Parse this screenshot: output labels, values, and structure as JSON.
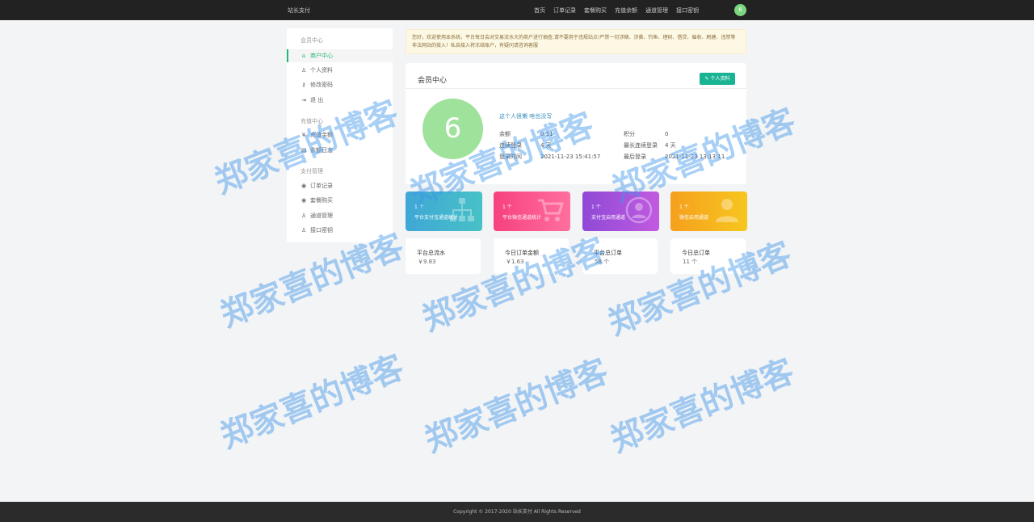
{
  "topbar": {
    "brand": "站长支付",
    "nav": [
      "首页",
      "订单记录",
      "套餐购买",
      "充值余额",
      "通道管理",
      "接口密钥"
    ],
    "avatar_text": "6"
  },
  "sidebar": {
    "section1": "会员中心",
    "section2": "充值中心",
    "section3": "支付管理",
    "items": [
      {
        "label": "商户中心",
        "icon": "home-icon",
        "glyph": "⌂"
      },
      {
        "label": "个人资料",
        "icon": "user-icon",
        "glyph": "♙"
      },
      {
        "label": "修改密码",
        "icon": "key-icon",
        "glyph": "⚷"
      },
      {
        "label": "退 出",
        "icon": "logout-icon",
        "glyph": "⇥"
      },
      {
        "label": "充值余额",
        "icon": "yen-icon",
        "glyph": "¥"
      },
      {
        "label": "余额日志",
        "icon": "list-icon",
        "glyph": "▤"
      },
      {
        "label": "订单记录",
        "icon": "user-circle-icon",
        "glyph": "◉"
      },
      {
        "label": "套餐购买",
        "icon": "user-circle-icon",
        "glyph": "◉"
      },
      {
        "label": "通道管理",
        "icon": "user-icon",
        "glyph": "♙"
      },
      {
        "label": "接口密钥",
        "icon": "user-icon",
        "glyph": "♙"
      }
    ]
  },
  "notice": "您好，欢迎使用本系统，平台每日会对交易流水大的商户进行抽查,请不要用于违规站点!严禁一切涉赌、涉黄、钓鱼、理财、借贷、催收、刷建、违禁等非法网站的接入！私自接入将冻结账户，有疑问请咨询客服",
  "member": {
    "title": "会员中心",
    "profile_button": "个人资料",
    "avatar_text": "6",
    "signature": "这个人很懒 啥也没写",
    "left": [
      {
        "k": "余额",
        "v": "0.11"
      },
      {
        "k": "连续登录",
        "v": "4 天"
      },
      {
        "k": "登录时间",
        "v": "2021-11-23 15:41:57"
      }
    ],
    "right": [
      {
        "k": "积分",
        "v": "0"
      },
      {
        "k": "最长连续登录",
        "v": "4 天"
      },
      {
        "k": "最后登录",
        "v": "2021-11-23 13:13:11"
      }
    ]
  },
  "cards": [
    {
      "count": "1 个",
      "label": "平台支付宝通道统计",
      "color": "#3fa7d6"
    },
    {
      "count": "1 个",
      "label": "平台微信通道统计",
      "color": "#f7417f"
    },
    {
      "count": "1 个",
      "label": "支付宝启用通道",
      "color": "#8f49d6"
    },
    {
      "count": "1 个",
      "label": "微信启用通道",
      "color": "#f5a01e"
    }
  ],
  "totals": [
    {
      "title": "平台总流水",
      "value": "￥9.83"
    },
    {
      "title": "今日订单金额",
      "value": "￥1.63"
    },
    {
      "title": "平台总订单",
      "value": "58 个"
    },
    {
      "title": "今日总订单",
      "value": "11 个"
    }
  ],
  "footer": "Copyright © 2017-2020 站长支付 All Rights Reserved",
  "watermark": "郑家喜的博客"
}
